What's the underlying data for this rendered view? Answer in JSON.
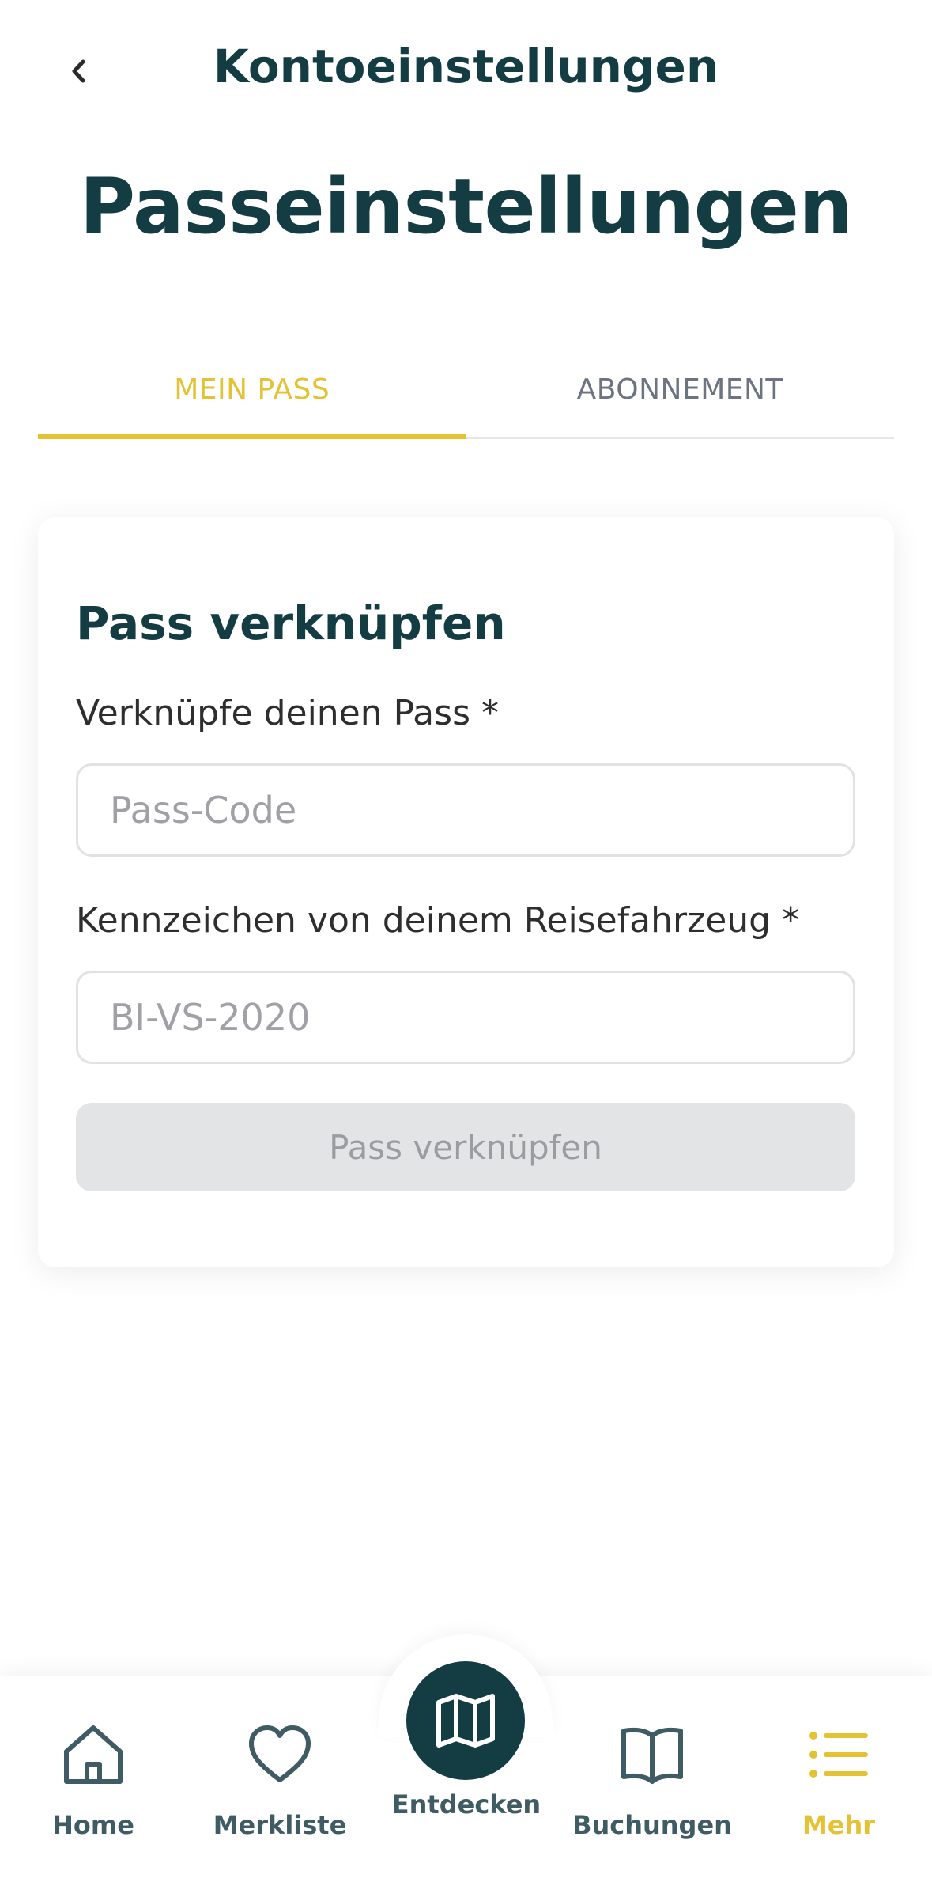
{
  "header": {
    "title": "Kontoeinstellungen"
  },
  "page": {
    "title": "Passeinstellungen"
  },
  "tabs": [
    {
      "label": "MEIN PASS",
      "active": true
    },
    {
      "label": "ABONNEMENT",
      "active": false
    }
  ],
  "card": {
    "title": "Pass verknüpfen",
    "pass_code": {
      "label": "Verknüpfe deinen Pass *",
      "placeholder": "Pass-Code",
      "value": ""
    },
    "license_plate": {
      "label": "Kennzeichen von deinem Reisefahrzeug *",
      "placeholder": "BI-VS-2020",
      "value": ""
    },
    "submit_label": "Pass verknüpfen"
  },
  "bottom_nav": {
    "items": [
      {
        "label": "Home",
        "icon": "home-icon"
      },
      {
        "label": "Merkliste",
        "icon": "heart-icon"
      },
      {
        "label": "Entdecken",
        "icon": "map-icon"
      },
      {
        "label": "Buchungen",
        "icon": "book-icon"
      },
      {
        "label": "Mehr",
        "icon": "list-icon",
        "active": true
      }
    ]
  },
  "colors": {
    "primary": "#133c43",
    "accent": "#e4c233",
    "muted": "#6b7480",
    "disabled_bg": "#e3e4e6"
  }
}
